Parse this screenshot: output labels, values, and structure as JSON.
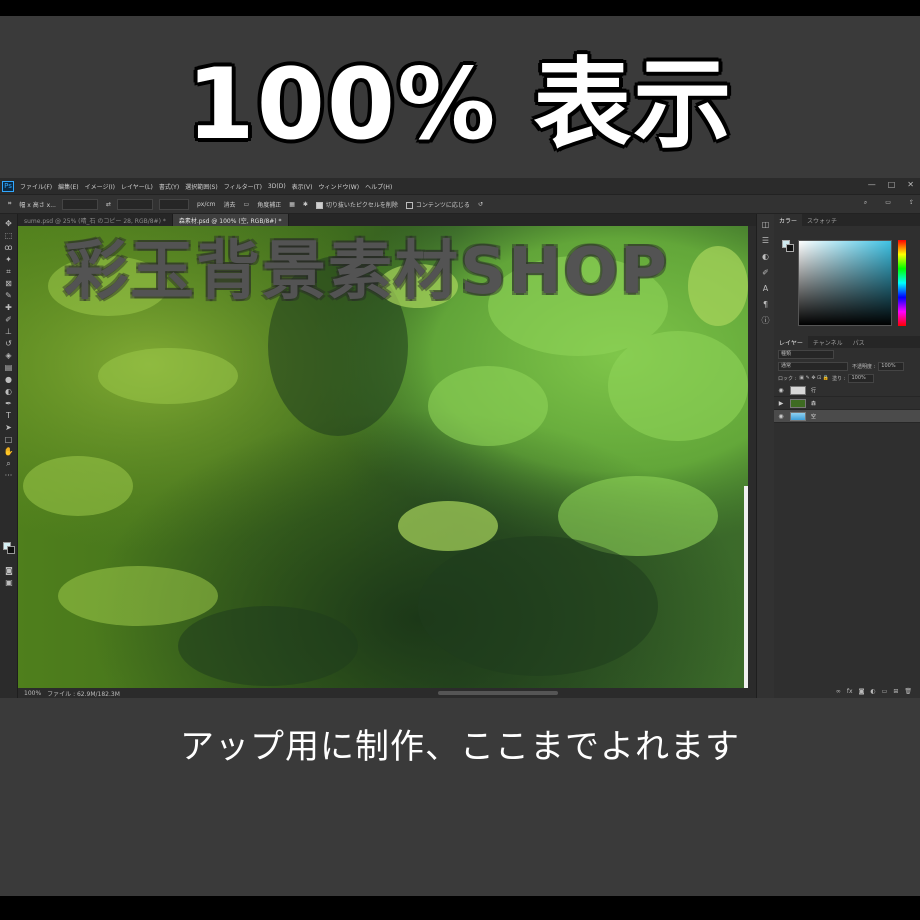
{
  "headline": "100% 表示",
  "caption": "アップ用に制作、ここまでよれます",
  "watermark": "彩玉背景素材SHOP",
  "app": {
    "logo": "Ps",
    "menu": [
      "ファイル(F)",
      "編集(E)",
      "イメージ(I)",
      "レイヤー(L)",
      "書式(Y)",
      "選択範囲(S)",
      "フィルター(T)",
      "3D(D)",
      "表示(V)",
      "ウィンドウ(W)",
      "ヘルプ(H)"
    ],
    "window_controls": [
      "—",
      "□",
      "✕"
    ]
  },
  "options": {
    "ratio_select": "幅 x 高さ x...",
    "unit": "px/cm",
    "clear": "消去",
    "straighten": "角度補正",
    "delete_cropped": "切り抜いたピクセルを削除",
    "content_aware": "コンテンツに応じる"
  },
  "document_tabs": [
    {
      "label": "sume.psd @ 25% (晴_石 のコピー 28, RGB/8#) *",
      "active": false
    },
    {
      "label": "森素材.psd @ 100% (空, RGB/8#) *",
      "active": true
    }
  ],
  "status": {
    "zoom": "100%",
    "file": "ファイル : 62.9M/182.3M"
  },
  "panels": {
    "color_tabs": [
      "カラー",
      "スウォッチ"
    ],
    "layer_tabs": [
      "レイヤー",
      "チャンネル",
      "パス"
    ],
    "kind": "種類",
    "blend": "通常",
    "opacity_label": "不透明度 :",
    "opacity": "100%",
    "lock_label": "ロック :",
    "fill_label": "塗り :",
    "fill": "100%",
    "layers": [
      {
        "name": "行",
        "thumb": "#d8d8d8",
        "selected": false
      },
      {
        "name": "森",
        "thumb": "#3e6b22",
        "selected": false
      },
      {
        "name": "空",
        "thumb": "#5fb3e3",
        "selected": true
      }
    ]
  },
  "colors": {
    "accent": "#31a8ff",
    "foreground": "#d6f0f4",
    "background": "#111111"
  }
}
